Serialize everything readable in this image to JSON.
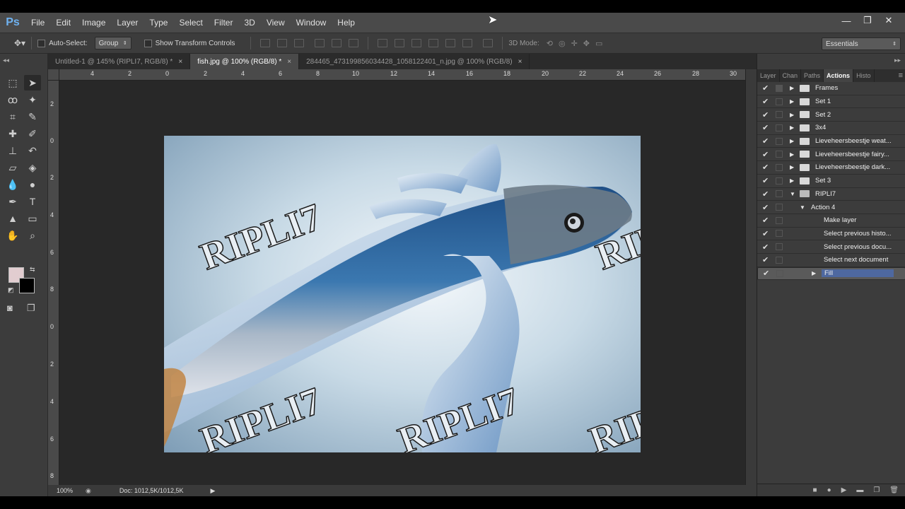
{
  "app": {
    "logo": "Ps"
  },
  "menu": [
    "File",
    "Edit",
    "Image",
    "Layer",
    "Type",
    "Select",
    "Filter",
    "3D",
    "View",
    "Window",
    "Help"
  ],
  "window_controls": {
    "minimize": "—",
    "restore": "❐",
    "close": "✕"
  },
  "options": {
    "auto_select_label": "Auto-Select:",
    "auto_select_value": "Group",
    "show_transform_label": "Show Transform Controls",
    "mode_3d_label": "3D Mode:",
    "workspace": "Essentials"
  },
  "tabs": [
    {
      "label": "Untitled-1 @ 145% (RIPLI7, RGB/8) *",
      "close": "×"
    },
    {
      "label": "fish.jpg @ 100% (RGB/8) *",
      "close": "×"
    },
    {
      "label": "284465_473199856034428_1058122401_n.jpg @ 100% (RGB/8)",
      "close": "×"
    }
  ],
  "ruler_h": [
    "4",
    "2",
    "0",
    "2",
    "4",
    "6",
    "8",
    "10",
    "12",
    "14",
    "16",
    "18",
    "20",
    "22",
    "24",
    "26",
    "28",
    "30"
  ],
  "ruler_v": [
    "2",
    "0",
    "2",
    "4",
    "6",
    "8",
    "0",
    "2",
    "4",
    "6",
    "8"
  ],
  "image": {
    "watermark": "RIPLI7"
  },
  "status": {
    "zoom": "100%",
    "doc": "Doc: 1012,5K/1012,5K"
  },
  "panel": {
    "tabs": [
      "Layer",
      "Chan",
      "Paths",
      "Actions",
      "Histo"
    ],
    "active_tab": "Actions",
    "actions": [
      {
        "label": "Frames",
        "type": "set"
      },
      {
        "label": "Set 1",
        "type": "set"
      },
      {
        "label": "Set 2",
        "type": "set"
      },
      {
        "label": "3x4",
        "type": "set"
      },
      {
        "label": "Lieveheersbeestje weat...",
        "type": "set"
      },
      {
        "label": "Lieveheersbeestje fairy...",
        "type": "set"
      },
      {
        "label": "Lieveheersbeestje dark...",
        "type": "set"
      },
      {
        "label": "Set 3",
        "type": "set"
      },
      {
        "label": "RIPLI7",
        "type": "set-open"
      },
      {
        "label": "Action 4",
        "type": "action-open"
      },
      {
        "label": "Make layer",
        "type": "step"
      },
      {
        "label": "Select previous histo...",
        "type": "step"
      },
      {
        "label": "Select previous docu...",
        "type": "step"
      },
      {
        "label": "Select next document",
        "type": "step"
      },
      {
        "label": "Fill",
        "type": "step-selected"
      }
    ]
  }
}
